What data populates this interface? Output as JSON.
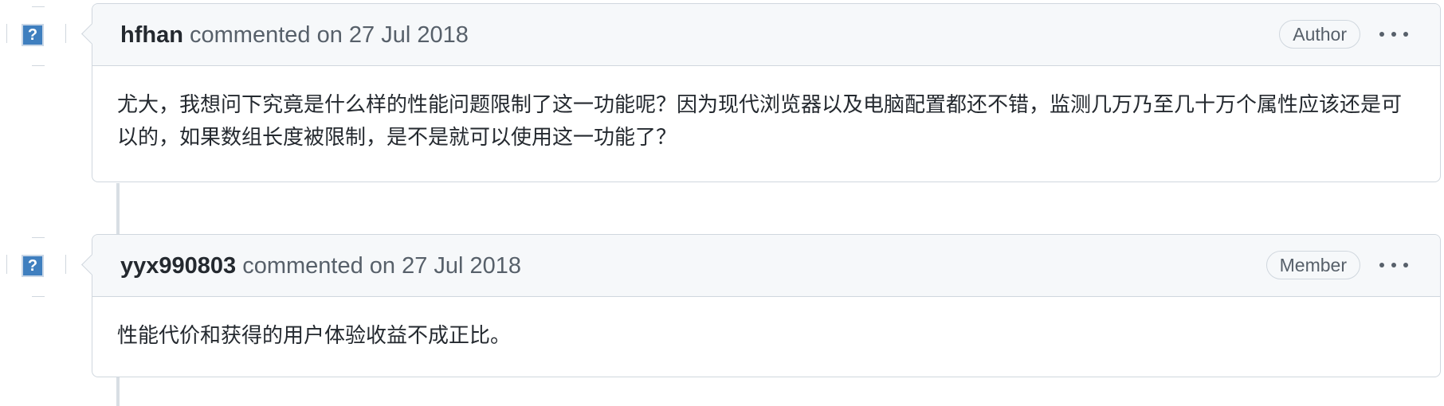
{
  "comments": [
    {
      "author": "hfhan",
      "action": "commented on",
      "date": "27 Jul 2018",
      "role": "Author",
      "avatar_glyph": "?",
      "body": "尤大，我想问下究竟是什么样的性能问题限制了这一功能呢？因为现代浏览器以及电脑配置都还不错，监测几万乃至几十万个属性应该还是可以的，如果数组长度被限制，是不是就可以使用这一功能了？"
    },
    {
      "author": "yyx990803",
      "action": "commented on",
      "date": "27 Jul 2018",
      "role": "Member",
      "avatar_glyph": "?",
      "body": "性能代价和获得的用户体验收益不成正比。"
    }
  ],
  "icons": {
    "more": "kebab-horizontal-icon",
    "avatar": "broken-avatar-icon"
  },
  "colors": {
    "header_bg": "#f6f8fa",
    "border": "#d0d7de",
    "muted_text": "#57606a",
    "avatar_bg": "#3f7fbf"
  }
}
